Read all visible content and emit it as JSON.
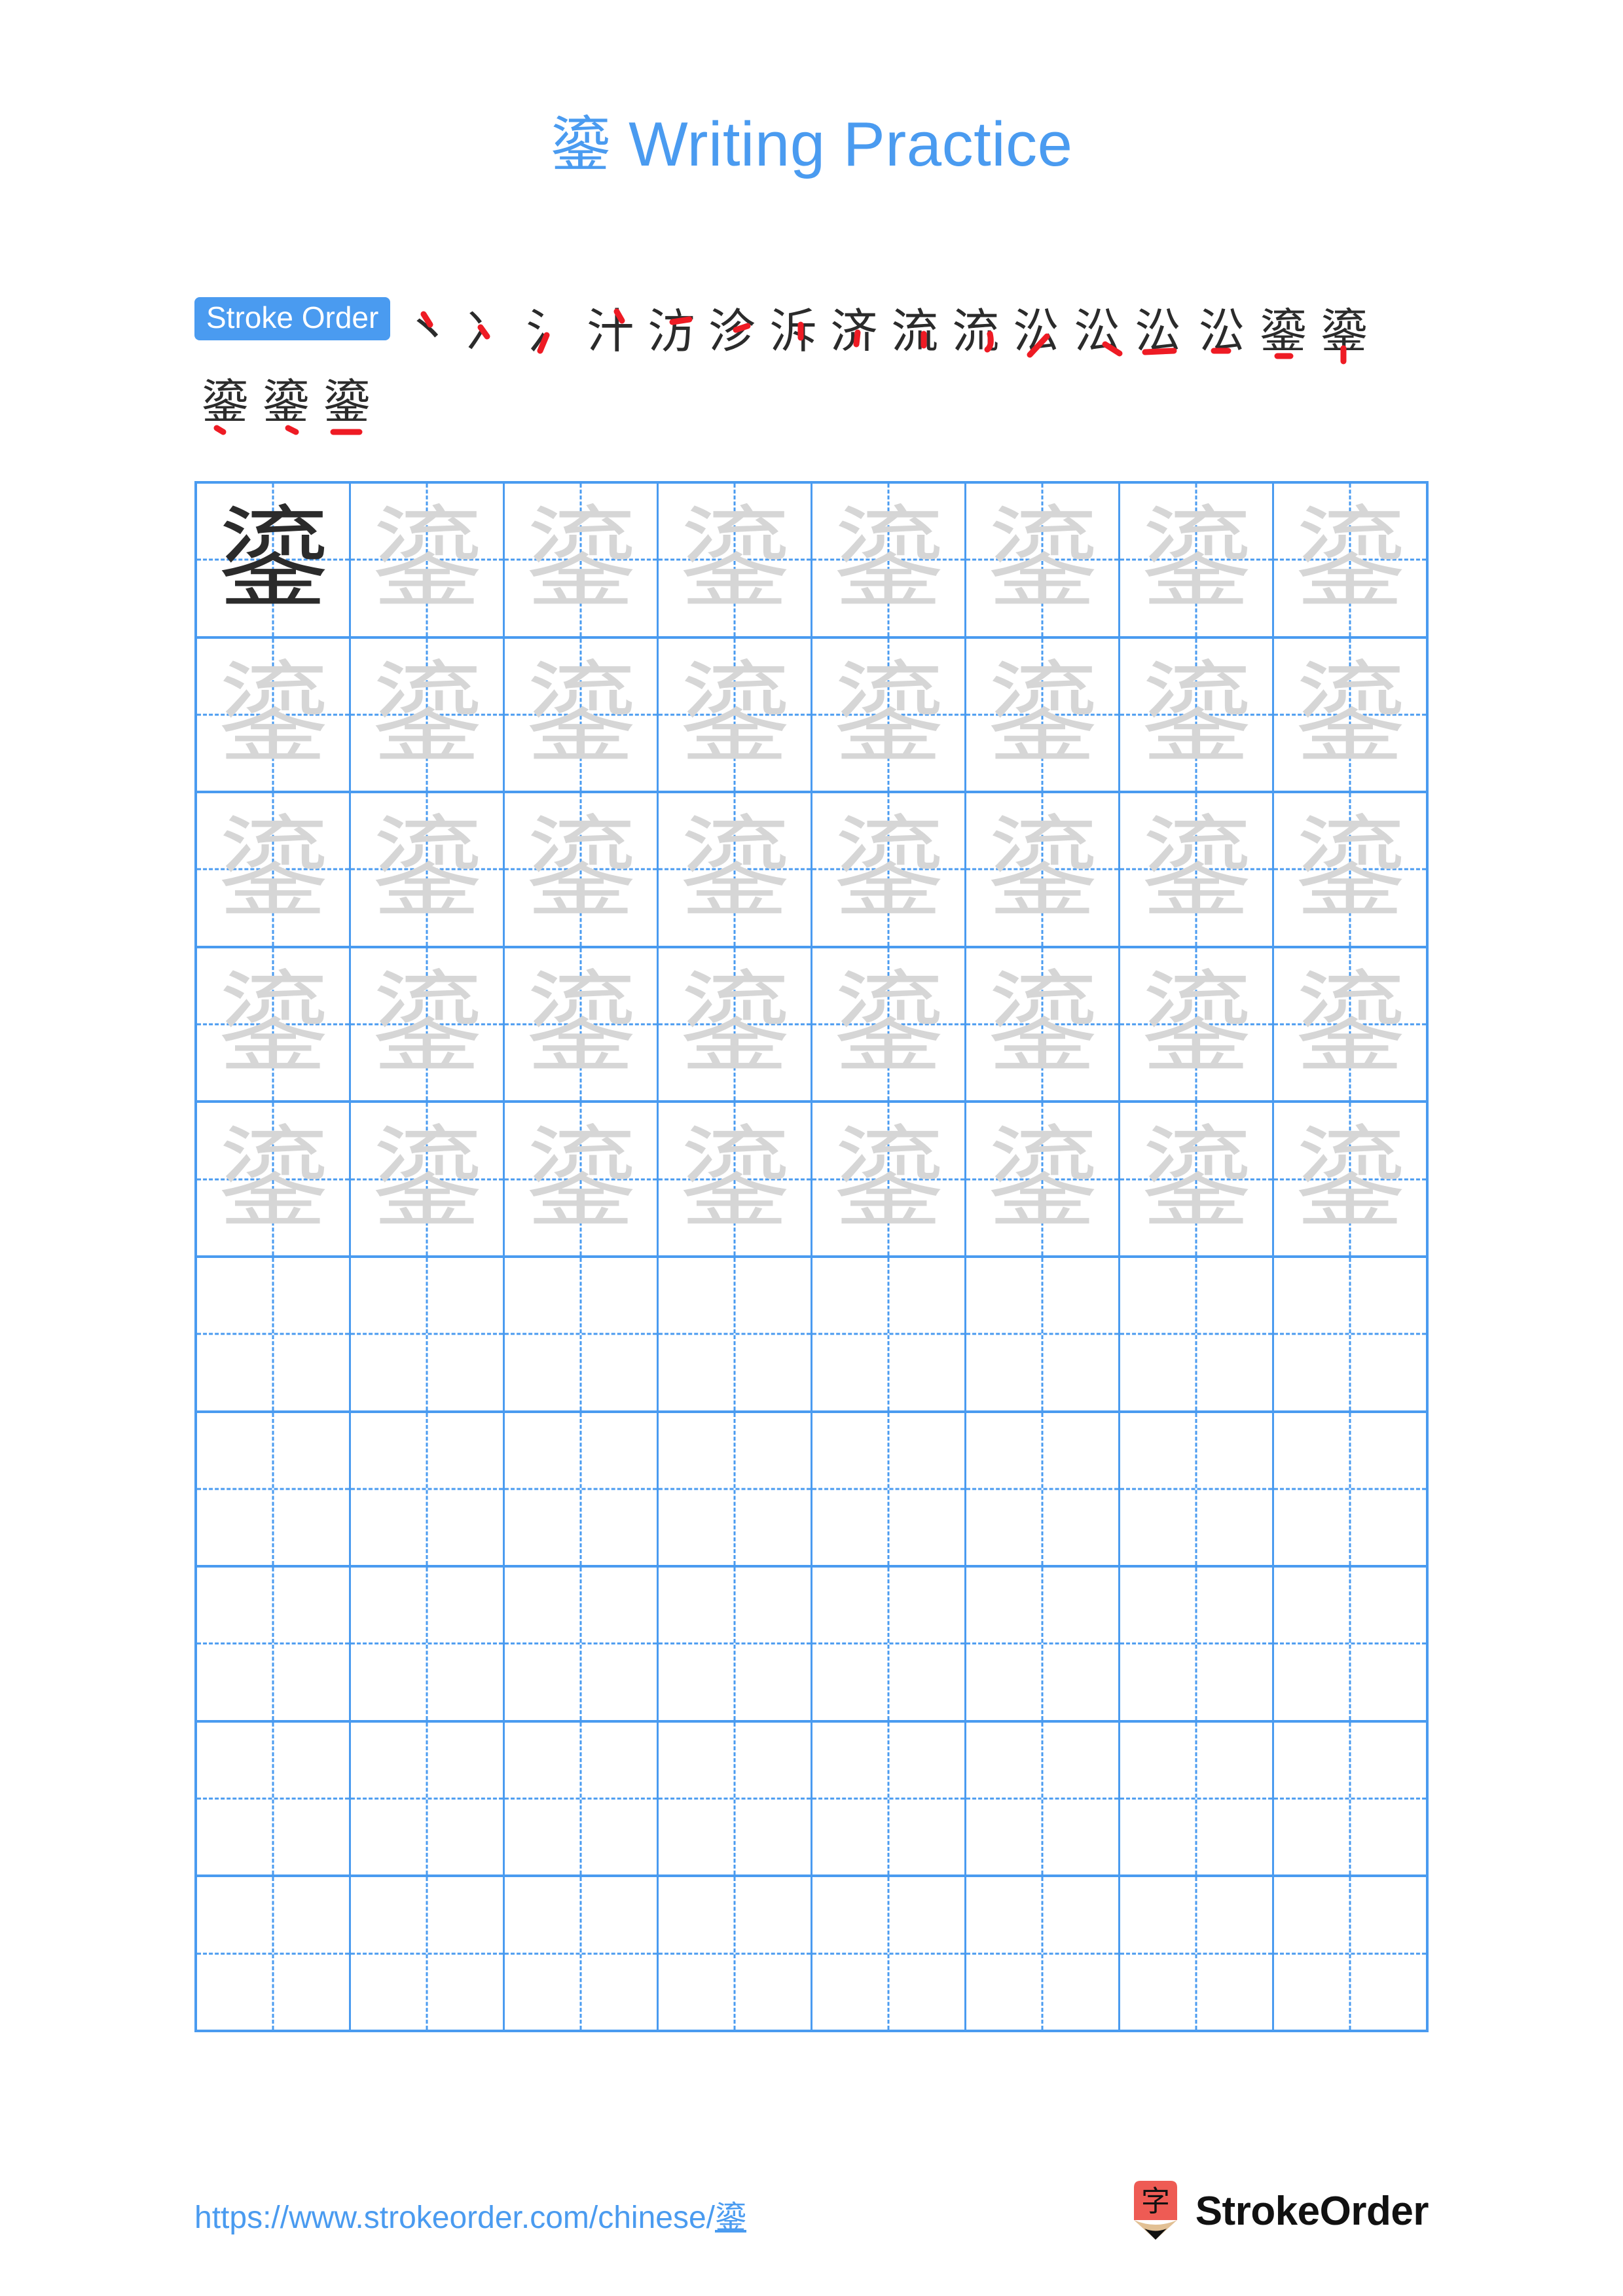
{
  "page": {
    "character": "鎏",
    "title_suffix": " Writing Practice",
    "background": "#ffffff",
    "accent_color": "#4a9bf0",
    "trace_color": "#d6d6d6",
    "ink_color": "#2b2b2b",
    "new_stroke_color": "#ee1b24"
  },
  "stroke_order": {
    "badge_label": "Stroke Order",
    "total_strokes": 19,
    "steps_row1": [
      {
        "index": 1,
        "glyph": "丶"
      },
      {
        "index": 2,
        "glyph": "冫"
      },
      {
        "index": 3,
        "glyph": "氵"
      },
      {
        "index": 4,
        "glyph": "汁"
      },
      {
        "index": 5,
        "glyph": "汸"
      },
      {
        "index": 6,
        "glyph": "沴"
      },
      {
        "index": 7,
        "glyph": "泝"
      },
      {
        "index": 8,
        "glyph": "济"
      },
      {
        "index": 9,
        "glyph": "流"
      },
      {
        "index": 10,
        "glyph": "流"
      },
      {
        "index": 11,
        "glyph": "㳂"
      },
      {
        "index": 12,
        "glyph": "㳂"
      },
      {
        "index": 13,
        "glyph": "㳂"
      }
    ],
    "steps_row2": [
      {
        "index": 14,
        "glyph": "㳂"
      },
      {
        "index": 15,
        "glyph": "鎏"
      },
      {
        "index": 16,
        "glyph": "鎏"
      },
      {
        "index": 17,
        "glyph": "鎏"
      },
      {
        "index": 18,
        "glyph": "鎏"
      },
      {
        "index": 19,
        "glyph": "鎏"
      }
    ]
  },
  "practice_grid": {
    "columns": 8,
    "rows": 10,
    "traced_rows": 5,
    "solid_cell": {
      "row": 1,
      "column": 1
    },
    "cell_character": "鎏"
  },
  "footer": {
    "url_prefix": "https://www.strokeorder.com/chinese/",
    "url_character": "鎏",
    "brand_name": "StrokeOrder",
    "logo_glyph": "字",
    "logo_body_color": "#ee5b54",
    "logo_wood_color": "#e2c094",
    "logo_tip_color": "#111111"
  }
}
